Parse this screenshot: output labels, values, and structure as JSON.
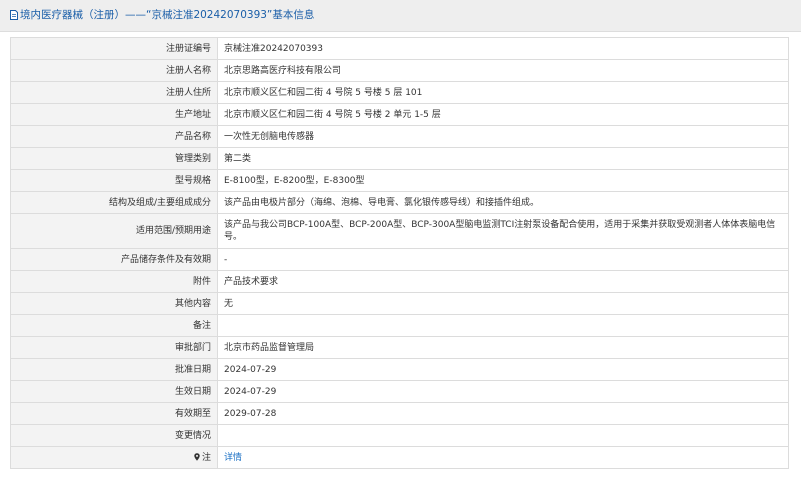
{
  "header": {
    "title": "境内医疗器械（注册）——“京械注准20242070393”基本信息"
  },
  "rows": [
    {
      "label": "注册证编号",
      "value": "京械注准20242070393"
    },
    {
      "label": "注册人名称",
      "value": "北京思路高医疗科技有限公司"
    },
    {
      "label": "注册人住所",
      "value": "北京市顺义区仁和园二街 4 号院 5 号楼 5 层 101"
    },
    {
      "label": "生产地址",
      "value": "北京市顺义区仁和园二街 4 号院 5 号楼 2 单元 1-5 层"
    },
    {
      "label": "产品名称",
      "value": "一次性无创脑电传感器"
    },
    {
      "label": "管理类别",
      "value": "第二类"
    },
    {
      "label": "型号规格",
      "value": "E-8100型，E-8200型，E-8300型"
    },
    {
      "label": "结构及组成/主要组成成分",
      "value": "该产品由电极片部分（海绵、泡棉、导电膏、氯化银传感导线）和接插件组成。"
    },
    {
      "label": "适用范围/预期用途",
      "value": "该产品与我公司BCP-100A型、BCP-200A型、BCP-300A型脑电监测TCI注射泵设备配合使用，适用于采集并获取受观测者人体体表脑电信号。"
    },
    {
      "label": "产品储存条件及有效期",
      "value": "-"
    },
    {
      "label": "附件",
      "value": "产品技术要求"
    },
    {
      "label": "其他内容",
      "value": "无"
    },
    {
      "label": "备注",
      "value": ""
    },
    {
      "label": "审批部门",
      "value": "北京市药品监督管理局"
    },
    {
      "label": "批准日期",
      "value": "2024-07-29"
    },
    {
      "label": "生效日期",
      "value": "2024-07-29"
    },
    {
      "label": "有效期至",
      "value": "2029-07-28"
    },
    {
      "label": "变更情况",
      "value": ""
    },
    {
      "label": "注",
      "value": "详情"
    }
  ]
}
